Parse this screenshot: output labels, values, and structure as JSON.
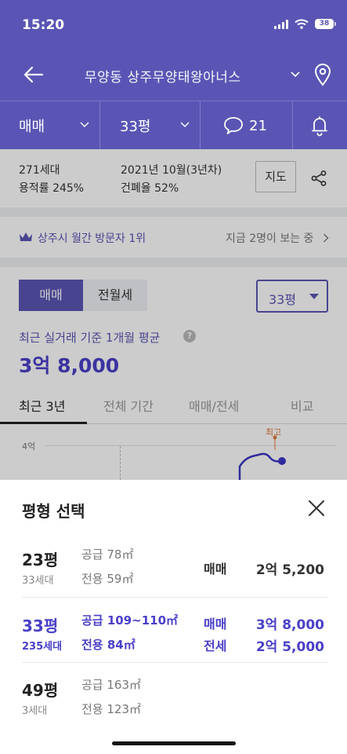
{
  "status": {
    "time": "15:20",
    "battery": "38"
  },
  "nav": {
    "title": "무양동 상주무양태왕아너스"
  },
  "filters": {
    "deal": "매매",
    "size": "33평",
    "comments": "21"
  },
  "info": {
    "households": "271세대",
    "far": "용적률 245%",
    "date": "2021년 10월(3년차)",
    "bcr": "건폐율 52%",
    "map_label": "지도"
  },
  "rank": {
    "text": "상주시 월간 방문자 1위",
    "viewers": "지금 2명이 보는 중"
  },
  "price_section": {
    "seg_sale": "매매",
    "seg_rent": "전월세",
    "size_select": "33평",
    "caption": "최근 실거래 기준 1개월 평균",
    "avg_price": "3억 8,000"
  },
  "tabs": [
    "최근 3년",
    "전체 기간",
    "매매/전세",
    "비교"
  ],
  "chart": {
    "y_tick": "4억",
    "peak_label": "최고"
  },
  "sheet": {
    "title": "평형 선택",
    "rows": [
      {
        "size": "23평",
        "households": "33세대",
        "supply": "공급 78㎡",
        "exclusive": "전용 59㎡",
        "deal1": "매매",
        "price1": "2억 5,200",
        "deal2": "",
        "price2": "",
        "selected": false
      },
      {
        "size": "33평",
        "households": "235세대",
        "supply": "공급 109~110㎡",
        "exclusive": "전용 84㎡",
        "deal1": "매매",
        "price1": "3억 8,000",
        "deal2": "전세",
        "price2": "2억 5,000",
        "selected": true
      },
      {
        "size": "49평",
        "households": "3세대",
        "supply": "공급 163㎡",
        "exclusive": "전용 123㎡",
        "deal1": "",
        "price1": "",
        "deal2": "",
        "price2": "",
        "selected": false
      }
    ]
  },
  "colors": {
    "brand": "#5a55b4",
    "selected_text": "#4a40c8",
    "chart_line": "#3b36c4",
    "peak": "#e07a3c"
  }
}
